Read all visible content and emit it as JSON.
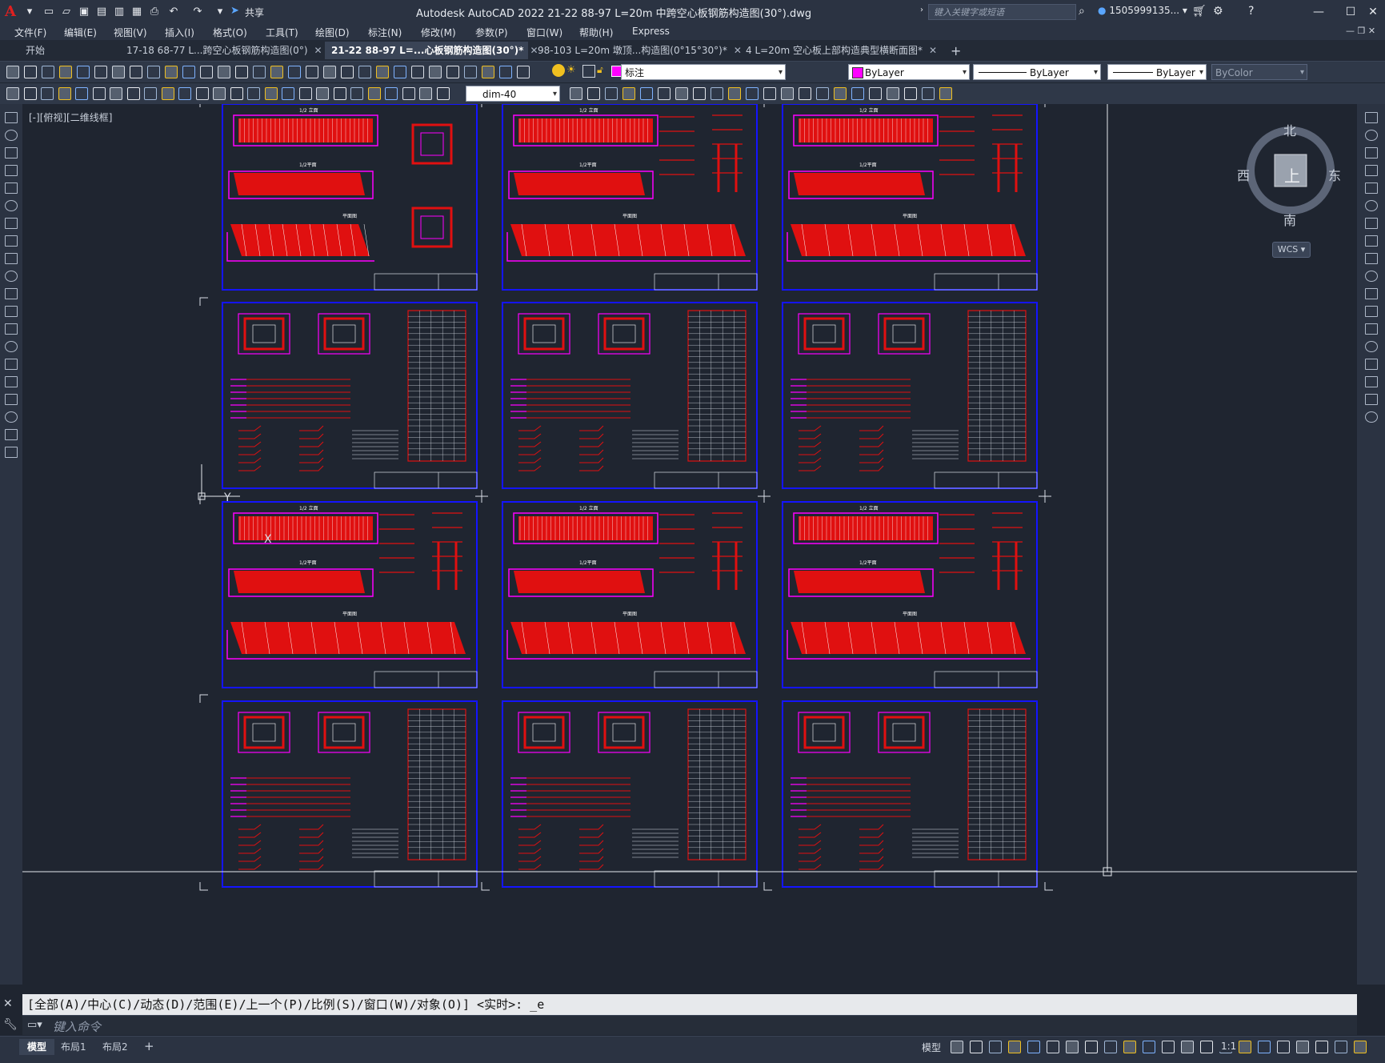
{
  "app": {
    "title": "Autodesk AutoCAD 2022    21-22 88-97 L=20m 中跨空心板钢筋构造图(30°).dwg",
    "share_label": "共享",
    "search_placeholder": "键入关键字或短语",
    "user": "1505999135...",
    "colors": {
      "accent_red": "#e01010",
      "magenta": "#ff00ff",
      "frame_blue": "#1414ff",
      "bg": "#1f2530"
    }
  },
  "menu": [
    "文件(F)",
    "编辑(E)",
    "视图(V)",
    "插入(I)",
    "格式(O)",
    "工具(T)",
    "绘图(D)",
    "标注(N)",
    "修改(M)",
    "参数(P)",
    "窗口(W)",
    "帮助(H)",
    "Express"
  ],
  "tabs": [
    {
      "label": "开始",
      "active": false
    },
    {
      "label": "17-18 68-77 L...跨空心板钢筋构造图(0°)",
      "active": false
    },
    {
      "label": "21-22 88-97 L=...心板钢筋构造图(30°)*",
      "active": true
    },
    {
      "label": "98-103 L=20m 墩顶...构造图(0°15°30°)*",
      "active": false
    },
    {
      "label": "4 L=20m 空心板上部构造典型横断面图*",
      "active": false
    }
  ],
  "toolbar": {
    "layer_value": "标注",
    "color_value": "ByLayer",
    "linetype_value": "ByLayer",
    "lineweight_value": "ByLayer",
    "plotstyle_value": "ByColor",
    "dimstyle_value": "dim-40"
  },
  "viewport": {
    "label": "[-][俯视][二维线框]",
    "compass": {
      "north": "北",
      "south": "南",
      "east": "东",
      "west": "西",
      "top": "上"
    },
    "wcs": "WCS ▾",
    "ucs_x": "X",
    "ucs_y": "Y"
  },
  "command": {
    "history": "[全部(A)/中心(C)/动态(D)/范围(E)/上一个(P)/比例(S)/窗口(W)/对象(O)] <实时>: _e",
    "placeholder": "键入命令"
  },
  "status": {
    "layouts": [
      "模型",
      "布局1",
      "布局2"
    ],
    "model_label": "模型",
    "scale": "1:1"
  },
  "drawing": {
    "sheet_types": [
      "elevation",
      "detail",
      "elevation",
      "detail"
    ],
    "sheet_labels": [
      "1/2 立面",
      "1/2平面",
      "平面图"
    ]
  }
}
